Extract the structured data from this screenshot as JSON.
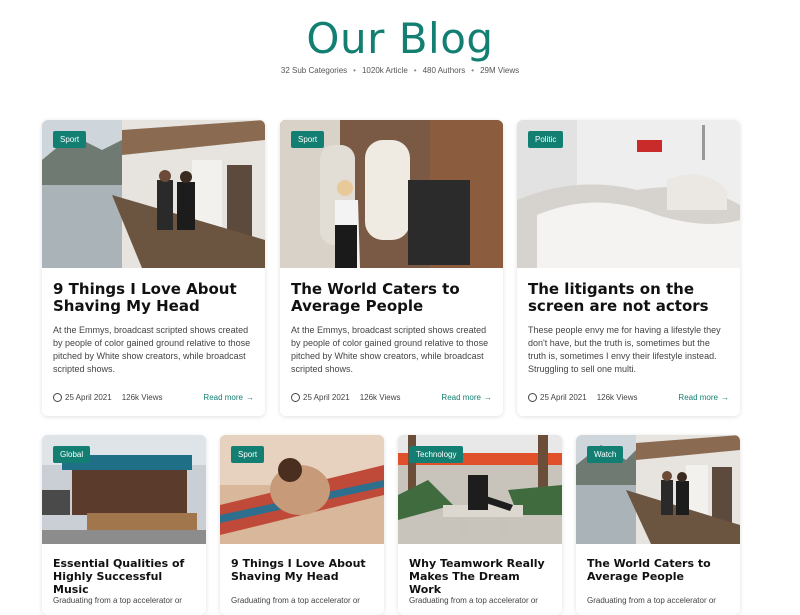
{
  "header": {
    "title": "Our Blog",
    "stats": [
      "32 Sub Categories",
      "1020k Article",
      "480 Authors",
      "29M Views"
    ]
  },
  "colors": {
    "accent": "#137f72"
  },
  "top_posts": [
    {
      "tag": "Sport",
      "title": "9 Things I Love About Shaving My Head",
      "excerpt": "At the Emmys, broadcast scripted shows created by people of color gained ground relative to those pitched by White show creators, while broadcast scripted shows.",
      "date": "25 April 2021",
      "views": "126k Views",
      "read_more": "Read more"
    },
    {
      "tag": "Sport",
      "title": "The World Caters to Average People",
      "excerpt": "At the Emmys, broadcast scripted shows created by people of color gained ground relative to those pitched by White show creators, while broadcast scripted shows.",
      "date": "25 April 2021",
      "views": "126k Views",
      "read_more": "Read more"
    },
    {
      "tag": "Politic",
      "title": "The litigants on the screen are not actors",
      "excerpt": "These people envy me for having a lifestyle they don't have, but the truth is, sometimes but the truth is, sometimes I envy their lifestyle instead. Struggling to sell one multi.",
      "date": "25 April 2021",
      "views": "126k Views",
      "read_more": "Read more"
    }
  ],
  "bottom_posts": [
    {
      "tag": "Global",
      "title": "Essential Qualities of Highly Successful Music",
      "excerpt": "Graduating from a top accelerator or"
    },
    {
      "tag": "Sport",
      "title": "9 Things I Love About Shaving My Head",
      "excerpt": "Graduating from a top accelerator or"
    },
    {
      "tag": "Technology",
      "title": "Why Teamwork Really Makes The Dream Work",
      "excerpt": "Graduating from a top accelerator or"
    },
    {
      "tag": "Watch",
      "title": "The World Caters to Average People",
      "excerpt": "Graduating from a top accelerator or"
    }
  ]
}
